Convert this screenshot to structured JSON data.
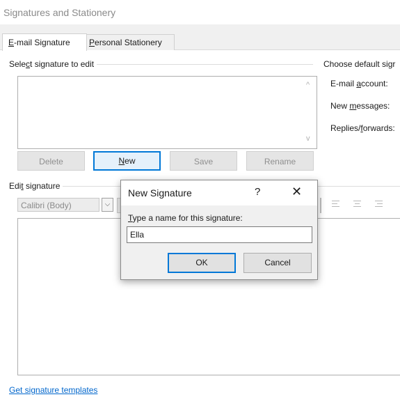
{
  "window": {
    "title": "Signatures and Stationery"
  },
  "tabs": {
    "email": {
      "mnemonic": "E",
      "rest": "-mail Signature"
    },
    "stationery": {
      "mnemonic": "P",
      "rest": "ersonal Stationery"
    }
  },
  "select_group": {
    "pre": "Sele",
    "mnemonic": "c",
    "post": "t signature to edit"
  },
  "signature_list": {
    "items": [],
    "scroll_up": "^",
    "scroll_down": "v"
  },
  "buttons": {
    "delete": "Delete",
    "new_mnemonic": "N",
    "new_rest": "ew",
    "save": "Save",
    "rename": "Rename"
  },
  "defaults": {
    "heading": "Choose default sigr",
    "email_account": {
      "pre": "E-mail ",
      "mnemonic": "a",
      "post": "ccount:"
    },
    "new_messages": {
      "pre": "New ",
      "mnemonic": "m",
      "post": "essages:"
    },
    "replies": {
      "pre": "Replies/",
      "mnemonic": "f",
      "post": "orwards:"
    }
  },
  "edit_group": {
    "pre": "Edi",
    "mnemonic": "t",
    "post": " signature"
  },
  "toolbar": {
    "font": "Calibri (Body)",
    "dropdown_glyph": "⌵"
  },
  "link": {
    "pre": "Get signature templ",
    "post": "ates"
  },
  "dialog": {
    "title": "New Signature",
    "help": "?",
    "close": "✕",
    "prompt_mnemonic": "T",
    "prompt_rest": "ype a name for this signature:",
    "input_value": "Ella",
    "ok": "OK",
    "cancel": "Cancel"
  }
}
